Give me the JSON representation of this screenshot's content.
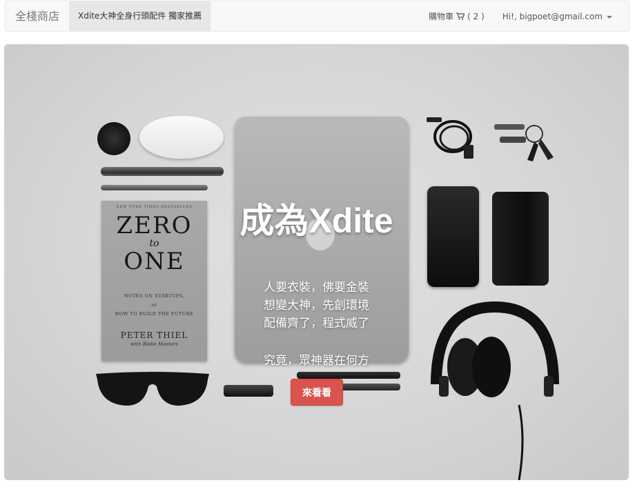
{
  "navbar": {
    "brand": "全棧商店",
    "active_item": "Xdite大神全身行頭配件 獨家推薦",
    "cart_label": "購物車",
    "cart_icon": "shopping-cart-icon",
    "cart_count": "( 2 )",
    "user_greeting": "Hi!, bigpoet@gmail.com",
    "dropdown_icon": "caret-down-icon"
  },
  "hero": {
    "title": "成為Xdite",
    "lines": [
      "人要衣裝，佛要金裝",
      "想變大神，先創環境",
      "配備齊了，程式威了"
    ],
    "question": "究竟，眾神器在何方",
    "cta_label": "來看看",
    "book": {
      "top_text": "NEW YORK TIMES BESTSELLER",
      "title_line1": "ZERO",
      "title_to": "to",
      "title_line2": "ONE",
      "notes_line1": "NOTES ON STARTUPS,",
      "notes_or": "or",
      "notes_line2": "HOW TO BUILD THE FUTURE",
      "author": "PETER THIEL",
      "with": "with Blake Masters"
    },
    "colors": {
      "cta": "#d9534f",
      "navbar_bg": "#f8f8f8",
      "active_bg": "#e7e7e7"
    }
  }
}
